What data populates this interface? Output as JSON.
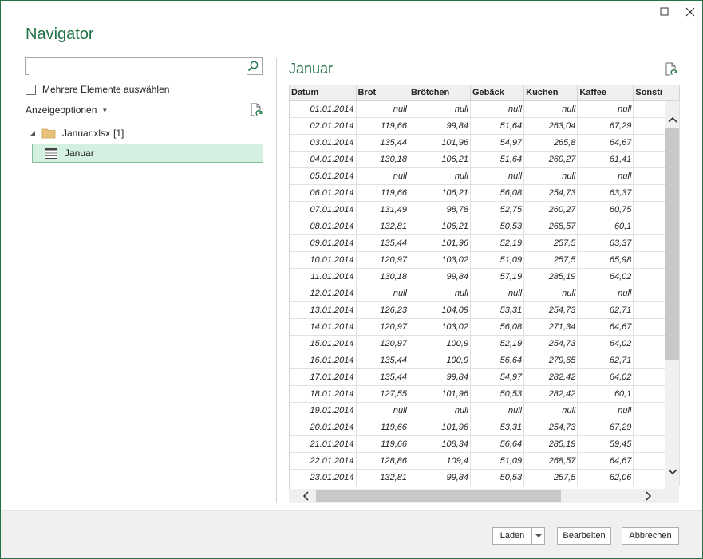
{
  "dialog": {
    "title": "Navigator"
  },
  "left": {
    "search_value": "",
    "multi_select_label": "Mehrere Elemente auswählen",
    "display_options_label": "Anzeigeoptionen",
    "tree": {
      "file_name": "Januar.xlsx",
      "file_count": "[1]",
      "selected_item": "Januar"
    }
  },
  "preview": {
    "title": "Januar",
    "columns": [
      "Datum",
      "Brot",
      "Brötchen",
      "Gebäck",
      "Kuchen",
      "Kaffee",
      "Sonsti"
    ],
    "rows": [
      [
        "01.01.2014",
        "null",
        "null",
        "null",
        "null",
        "null"
      ],
      [
        "02.01.2014",
        "119,66",
        "99,84",
        "51,64",
        "263,04",
        "67,29"
      ],
      [
        "03.01.2014",
        "135,44",
        "101,96",
        "54,97",
        "265,8",
        "64,67"
      ],
      [
        "04.01.2014",
        "130,18",
        "106,21",
        "51,64",
        "260,27",
        "61,41"
      ],
      [
        "05.01.2014",
        "null",
        "null",
        "null",
        "null",
        "null"
      ],
      [
        "06.01.2014",
        "119,66",
        "106,21",
        "56,08",
        "254,73",
        "63,37"
      ],
      [
        "07.01.2014",
        "131,49",
        "98,78",
        "52,75",
        "260,27",
        "60,75"
      ],
      [
        "08.01.2014",
        "132,81",
        "106,21",
        "50,53",
        "268,57",
        "60,1"
      ],
      [
        "09.01.2014",
        "135,44",
        "101,96",
        "52,19",
        "257,5",
        "63,37"
      ],
      [
        "10.01.2014",
        "120,97",
        "103,02",
        "51,09",
        "257,5",
        "65,98"
      ],
      [
        "11.01.2014",
        "130,18",
        "99,84",
        "57,19",
        "285,19",
        "64,02"
      ],
      [
        "12.01.2014",
        "null",
        "null",
        "null",
        "null",
        "null"
      ],
      [
        "13.01.2014",
        "126,23",
        "104,09",
        "53,31",
        "254,73",
        "62,71"
      ],
      [
        "14.01.2014",
        "120,97",
        "103,02",
        "56,08",
        "271,34",
        "64,67"
      ],
      [
        "15.01.2014",
        "120,97",
        "100,9",
        "52,19",
        "254,73",
        "64,02"
      ],
      [
        "16.01.2014",
        "135,44",
        "100,9",
        "56,64",
        "279,65",
        "62,71"
      ],
      [
        "17.01.2014",
        "135,44",
        "99,84",
        "54,97",
        "282,42",
        "64,02"
      ],
      [
        "18.01.2014",
        "127,55",
        "101,96",
        "50,53",
        "282,42",
        "60,1"
      ],
      [
        "19.01.2014",
        "null",
        "null",
        "null",
        "null",
        "null"
      ],
      [
        "20.01.2014",
        "119,66",
        "101,96",
        "53,31",
        "254,73",
        "67,29"
      ],
      [
        "21.01.2014",
        "119,66",
        "108,34",
        "56,64",
        "285,19",
        "59,45"
      ],
      [
        "22.01.2014",
        "128,86",
        "109,4",
        "51,09",
        "268,57",
        "64,67"
      ],
      [
        "23.01.2014",
        "132,81",
        "99,84",
        "50,53",
        "257,5",
        "62,06"
      ]
    ]
  },
  "buttons": {
    "load": "Laden",
    "edit": "Bearbeiten",
    "cancel": "Abbrechen"
  },
  "colors": {
    "accent": "#217346",
    "selection": "#d3f0e0"
  }
}
